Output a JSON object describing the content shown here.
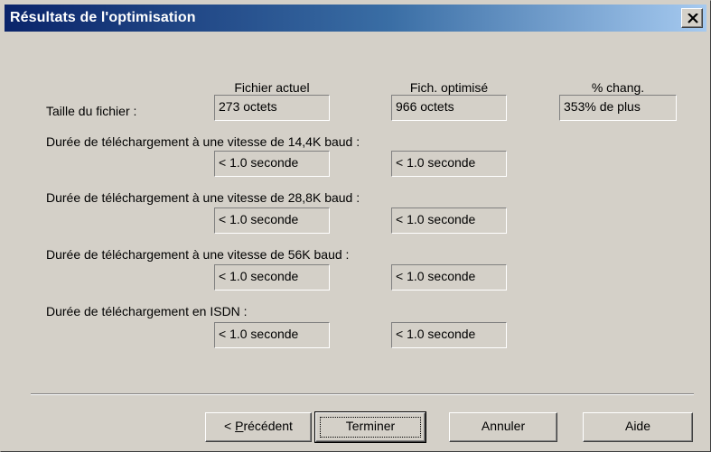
{
  "window": {
    "title": "Résultats de l'optimisation",
    "close_symbol": "×"
  },
  "columns": {
    "current": "Fichier actuel",
    "optimized": "Fich. optimisé",
    "change": "% chang."
  },
  "file_size": {
    "label": "Taille du fichier :",
    "current": "273 octets",
    "optimized": "966 octets",
    "change": "353% de plus"
  },
  "downloads": [
    {
      "label": "Durée de téléchargement à une vitesse de 14,4K baud :",
      "current": "< 1.0 seconde",
      "optimized": "< 1.0 seconde"
    },
    {
      "label": "Durée de téléchargement à une vitesse de 28,8K baud :",
      "current": "< 1.0 seconde",
      "optimized": "< 1.0 seconde"
    },
    {
      "label": "Durée de téléchargement à une vitesse de 56K baud :",
      "current": "< 1.0 seconde",
      "optimized": "< 1.0 seconde"
    },
    {
      "label": "Durée de téléchargement en ISDN :",
      "current": "< 1.0 seconde",
      "optimized": "< 1.0 seconde"
    }
  ],
  "buttons": {
    "previous_prefix": "< ",
    "previous_mnemonic": "P",
    "previous_rest": "récédent",
    "finish": "Terminer",
    "cancel": "Annuler",
    "help": "Aide"
  }
}
